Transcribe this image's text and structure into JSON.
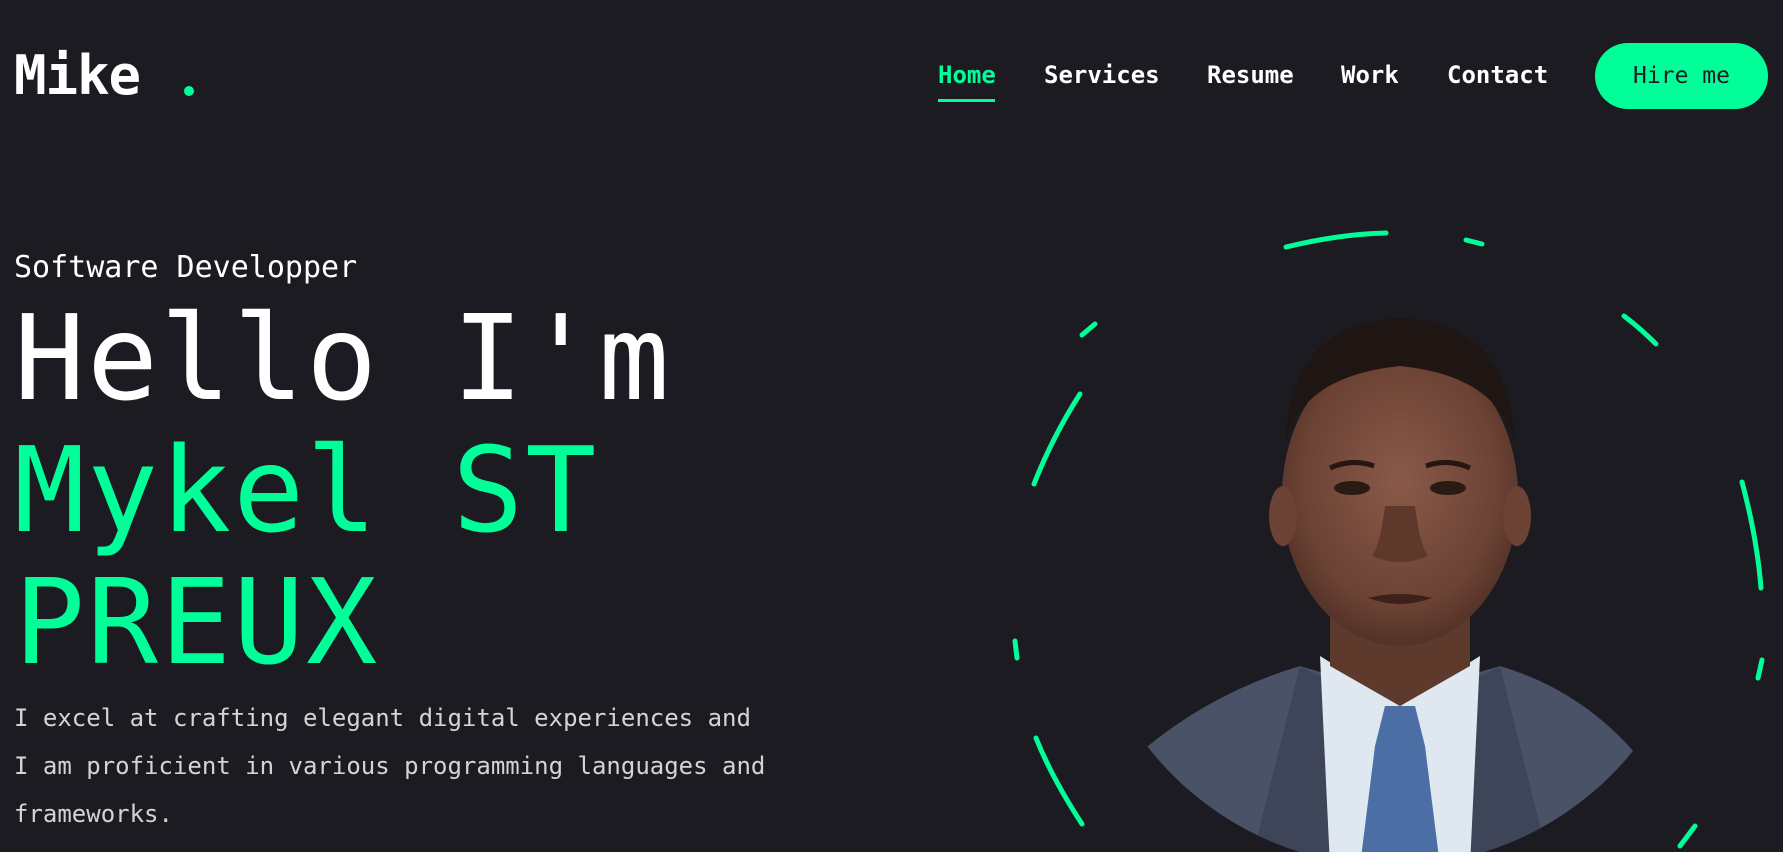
{
  "header": {
    "logo": "Mike",
    "nav": [
      {
        "label": "Home",
        "active": true
      },
      {
        "label": "Services",
        "active": false
      },
      {
        "label": "Resume",
        "active": false
      },
      {
        "label": "Work",
        "active": false
      },
      {
        "label": "Contact",
        "active": false
      }
    ],
    "cta_label": "Hire me"
  },
  "hero": {
    "role": "Software Developper",
    "greeting": "Hello I'm",
    "name_line1": "Mykel ST",
    "name_line2": "PREUX",
    "description_lines": [
      "I excel at crafting elegant digital experiences and",
      "I am proficient in various programming languages and",
      "frameworks."
    ]
  },
  "colors": {
    "background": "#1c1b22",
    "accent": "#00ff99",
    "text": "#ffffff"
  }
}
